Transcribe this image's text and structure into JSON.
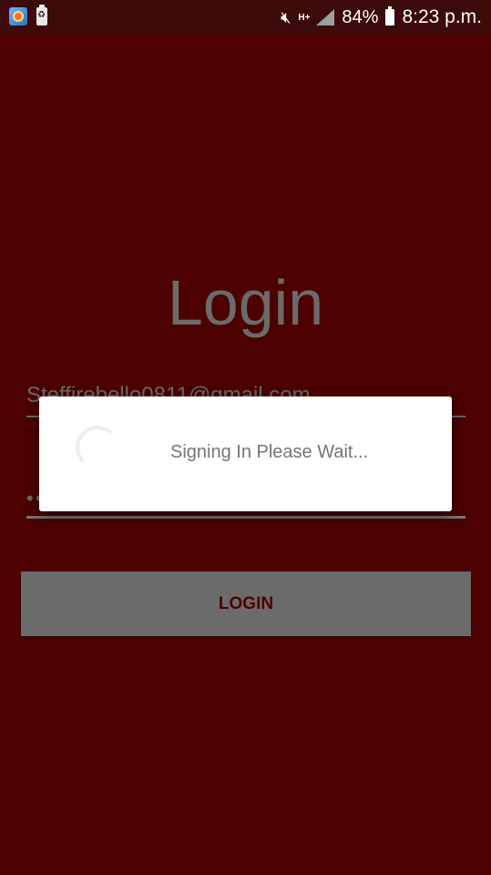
{
  "status_bar": {
    "battery_percent": "84%",
    "time": "8:23 p.m.",
    "network_type": "H+",
    "icons": {
      "app": "app-notification-icon",
      "battery_saver": "battery-saver-icon",
      "mute": "mute-icon",
      "signal": "signal-icon",
      "battery": "battery-icon"
    }
  },
  "login": {
    "title": "Login",
    "email_value": "Steffirebello0811@gmail.com",
    "password_value": "••••••••",
    "button_label": "LOGIN"
  },
  "dialog": {
    "message": "Signing In Please Wait..."
  },
  "colors": {
    "background": "#4d0000",
    "status_bar": "#3d0a0a",
    "muted_gray": "#6b6b6b",
    "dialog_bg": "#ffffff",
    "dialog_text": "#757575"
  }
}
